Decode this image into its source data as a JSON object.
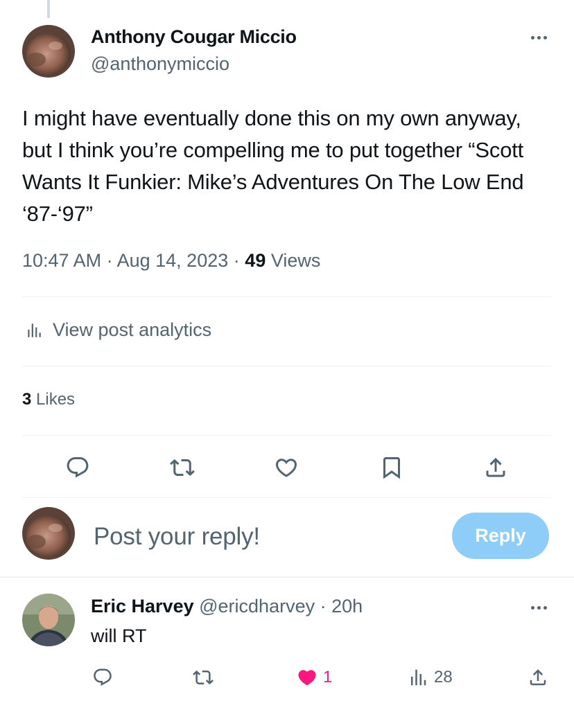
{
  "main_post": {
    "author_name": "Anthony Cougar Miccio",
    "author_handle": "@anthonymiccio",
    "text": "I might have eventually done this on my own anyway, but I think you’re compelling me to put together “Scott Wants It Funkier: Mike’s Adventures On The Low End ‘87-‘97”",
    "time": "10:47 AM",
    "date": "Aug 14, 2023",
    "separator": "·",
    "views_count": "49",
    "views_label": "Views",
    "analytics_label": "View post analytics",
    "likes_count": "3",
    "likes_label": "Likes",
    "actions": [
      "reply-icon",
      "repost-icon",
      "like-icon",
      "bookmark-icon",
      "share-icon"
    ]
  },
  "composer": {
    "placeholder": "Post your reply!",
    "button_label": "Reply"
  },
  "reply": {
    "author_name": "Eric Harvey",
    "author_handle": "@ericdharvey",
    "time_ago": "· 20h",
    "text": "will RT",
    "like_count": "1",
    "views_count": "28"
  },
  "colors": {
    "text_primary": "#0f1419",
    "text_secondary": "#536471",
    "divider": "#eff3f4",
    "reply_button": "#8ecdf8",
    "like_active": "#f91880"
  }
}
